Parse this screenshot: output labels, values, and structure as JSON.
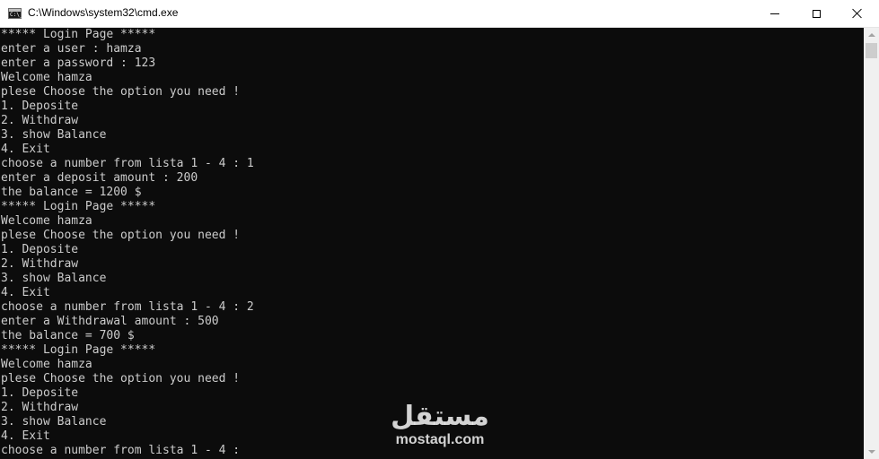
{
  "window": {
    "title": "C:\\Windows\\system32\\cmd.exe",
    "icon_text": "C:\\_"
  },
  "console": {
    "lines": [
      "***** Login Page *****",
      "enter a user : hamza",
      "enter a password : 123",
      "Welcome hamza",
      "plese Choose the option you need !",
      "1. Deposite",
      "2. Withdraw",
      "3. show Balance",
      "4. Exit",
      "choose a number from lista 1 - 4 : 1",
      "enter a deposit amount : 200",
      "the balance = 1200 $",
      "***** Login Page *****",
      "Welcome hamza",
      "plese Choose the option you need !",
      "1. Deposite",
      "2. Withdraw",
      "3. show Balance",
      "4. Exit",
      "choose a number from lista 1 - 4 : 2",
      "enter a Withdrawal amount : 500",
      "the balance = 700 $",
      "***** Login Page *****",
      "Welcome hamza",
      "plese Choose the option you need !",
      "1. Deposite",
      "2. Withdraw",
      "3. show Balance",
      "4. Exit",
      "choose a number from lista 1 - 4 :"
    ]
  },
  "watermark": {
    "arabic": "مستقل",
    "latin": "mostaql.com"
  },
  "colors": {
    "console_bg": "#0c0c0c",
    "console_text": "#cccccc",
    "titlebar_bg": "#ffffff"
  },
  "icons": {
    "app": "cmd-icon",
    "minimize": "minimize-icon",
    "maximize": "maximize-icon",
    "close": "close-icon",
    "scroll_up": "arrow-up-icon",
    "scroll_down": "arrow-down-icon"
  }
}
